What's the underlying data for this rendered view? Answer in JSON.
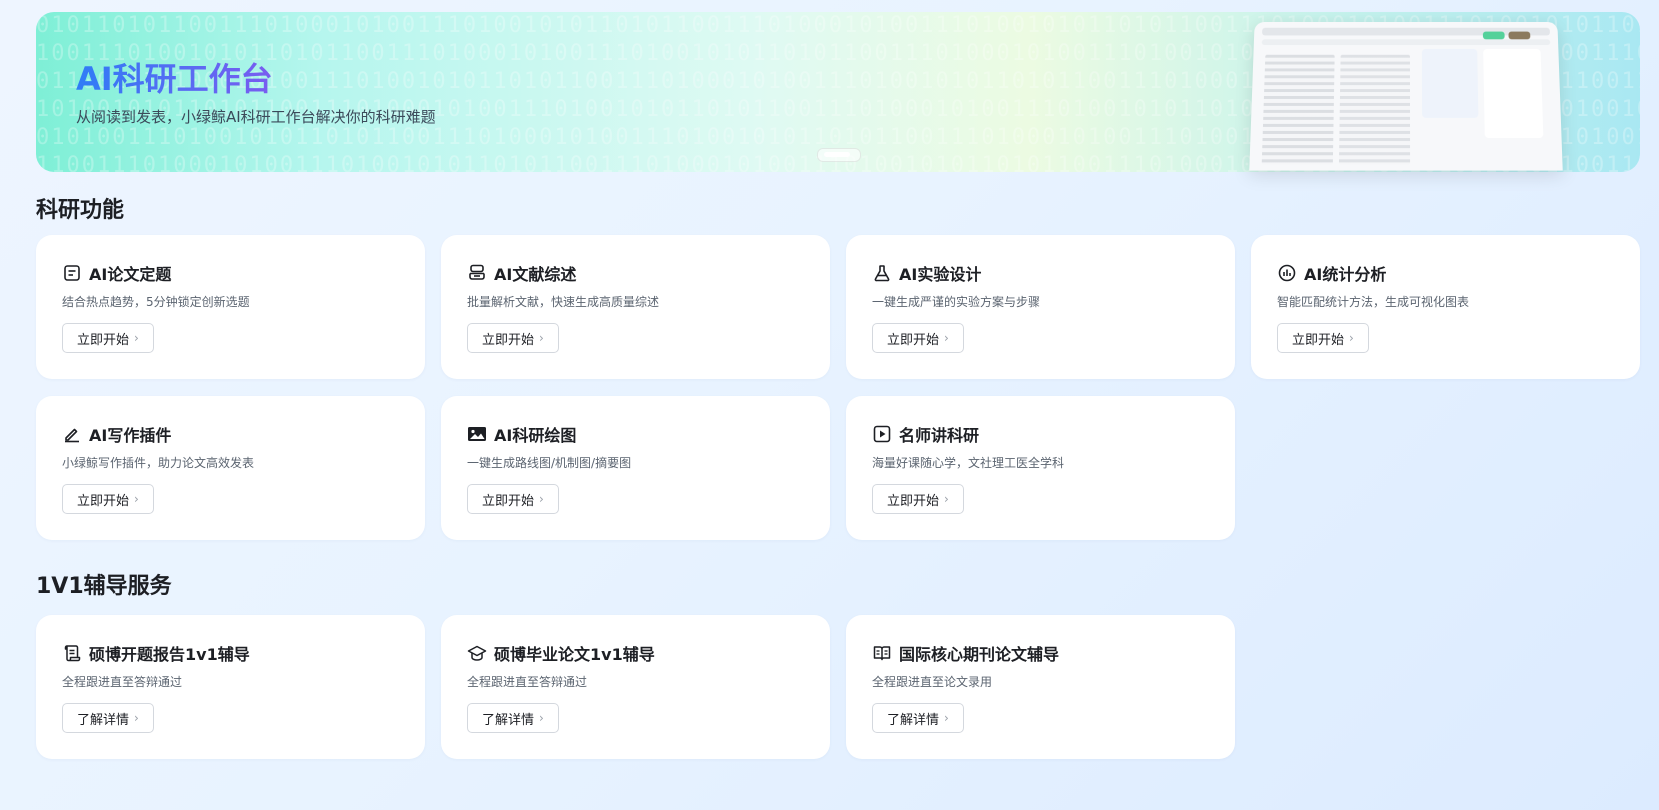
{
  "banner": {
    "title": "AI科研工作台",
    "subtitle": "从阅读到发表，小绿鲸AI科研工作台解决你的科研难题"
  },
  "sections": {
    "research_title": "科研功能",
    "tutoring_title": "1V1辅导服务"
  },
  "research_cards": [
    {
      "title": "AI论文定题",
      "desc": "结合热点趋势，5分钟锁定创新选题",
      "button": "立即开始",
      "icon": "document-lines-icon"
    },
    {
      "title": "AI文献综述",
      "desc": "批量解析文献，快速生成高质量综述",
      "button": "立即开始",
      "icon": "stack-icon"
    },
    {
      "title": "AI实验设计",
      "desc": "一键生成严谨的实验方案与步骤",
      "button": "立即开始",
      "icon": "flask-icon"
    },
    {
      "title": "AI统计分析",
      "desc": "智能匹配统计方法，生成可视化图表",
      "button": "立即开始",
      "icon": "bar-chart-icon"
    },
    {
      "title": "AI写作插件",
      "desc": "小绿鲸写作插件，助力论文高效发表",
      "button": "立即开始",
      "icon": "pencil-icon"
    },
    {
      "title": "AI科研绘图",
      "desc": "一键生成路线图/机制图/摘要图",
      "button": "立即开始",
      "icon": "image-icon"
    },
    {
      "title": "名师讲科研",
      "desc": "海量好课随心学，文社理工医全学科",
      "button": "立即开始",
      "icon": "video-play-icon"
    }
  ],
  "tutoring_cards": [
    {
      "title": "硕博开题报告1v1辅导",
      "desc": "全程跟进直至答辩通过",
      "button": "了解详情",
      "icon": "scroll-icon"
    },
    {
      "title": "硕博毕业论文1v1辅导",
      "desc": "全程跟进直至答辩通过",
      "button": "了解详情",
      "icon": "graduation-cap-icon"
    },
    {
      "title": "国际核心期刊论文辅导",
      "desc": "全程跟进直至论文录用",
      "button": "了解详情",
      "icon": "open-book-icon"
    }
  ],
  "colors": {
    "accent_gradient_start": "#2f7df6",
    "accent_gradient_end": "#7a5cf0",
    "banner_green": "#7eefd6"
  }
}
